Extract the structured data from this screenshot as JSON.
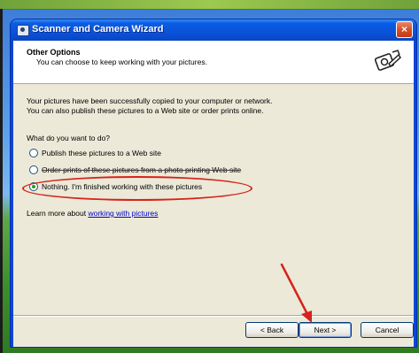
{
  "window": {
    "title": "Scanner and Camera Wizard",
    "close_label": "×"
  },
  "header": {
    "title": "Other Options",
    "subtitle": "You can choose to keep working with your pictures."
  },
  "main": {
    "intro_line1": "Your pictures have been successfully copied to your computer or network.",
    "intro_line2": "You can also publish these pictures to a Web site or order prints online.",
    "question": "What do you want to do?",
    "options": [
      {
        "label": "Publish these pictures to a Web site",
        "checked": false
      },
      {
        "label": "Order prints of these pictures from a photo printing Web site",
        "checked": false
      },
      {
        "label": "Nothing. I'm finished working with these pictures",
        "checked": true
      }
    ],
    "learn_more_prefix": "Learn more about",
    "learn_more_link": "working with pictures"
  },
  "footer": {
    "back_label": "< Back",
    "next_label": "Next >",
    "cancel_label": "Cancel"
  },
  "colors": {
    "annotation": "#d6231c",
    "titlebar": "#0a52d8",
    "dialog_bg": "#ece9d8"
  }
}
